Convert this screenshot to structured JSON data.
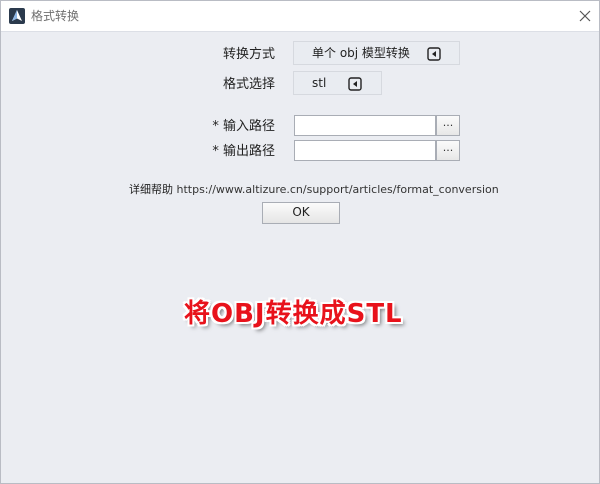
{
  "window": {
    "title": "格式转换"
  },
  "form": {
    "conversion_mode_label": "转换方式",
    "conversion_mode_value": "单个 obj 模型转换",
    "format_label": "格式选择",
    "format_value": "stl",
    "input_path_label": "* 输入路径",
    "output_path_label": "* 输出路径",
    "input_path_value": "",
    "output_path_value": "",
    "browse_label": "..."
  },
  "help": {
    "label": "详细帮助",
    "url": "https://www.altizure.cn/support/articles/format_conversion"
  },
  "ok_label": "OK",
  "overlay_caption": "将OBJ转换成STL",
  "icons": {
    "app": "app-logo-icon",
    "close": "close-icon",
    "dropdown": "dropdown-arrow-icon"
  },
  "colors": {
    "window_bg": "#ebedf2",
    "titlebar_bg": "#ffffff",
    "caption_red": "#e8121b"
  }
}
